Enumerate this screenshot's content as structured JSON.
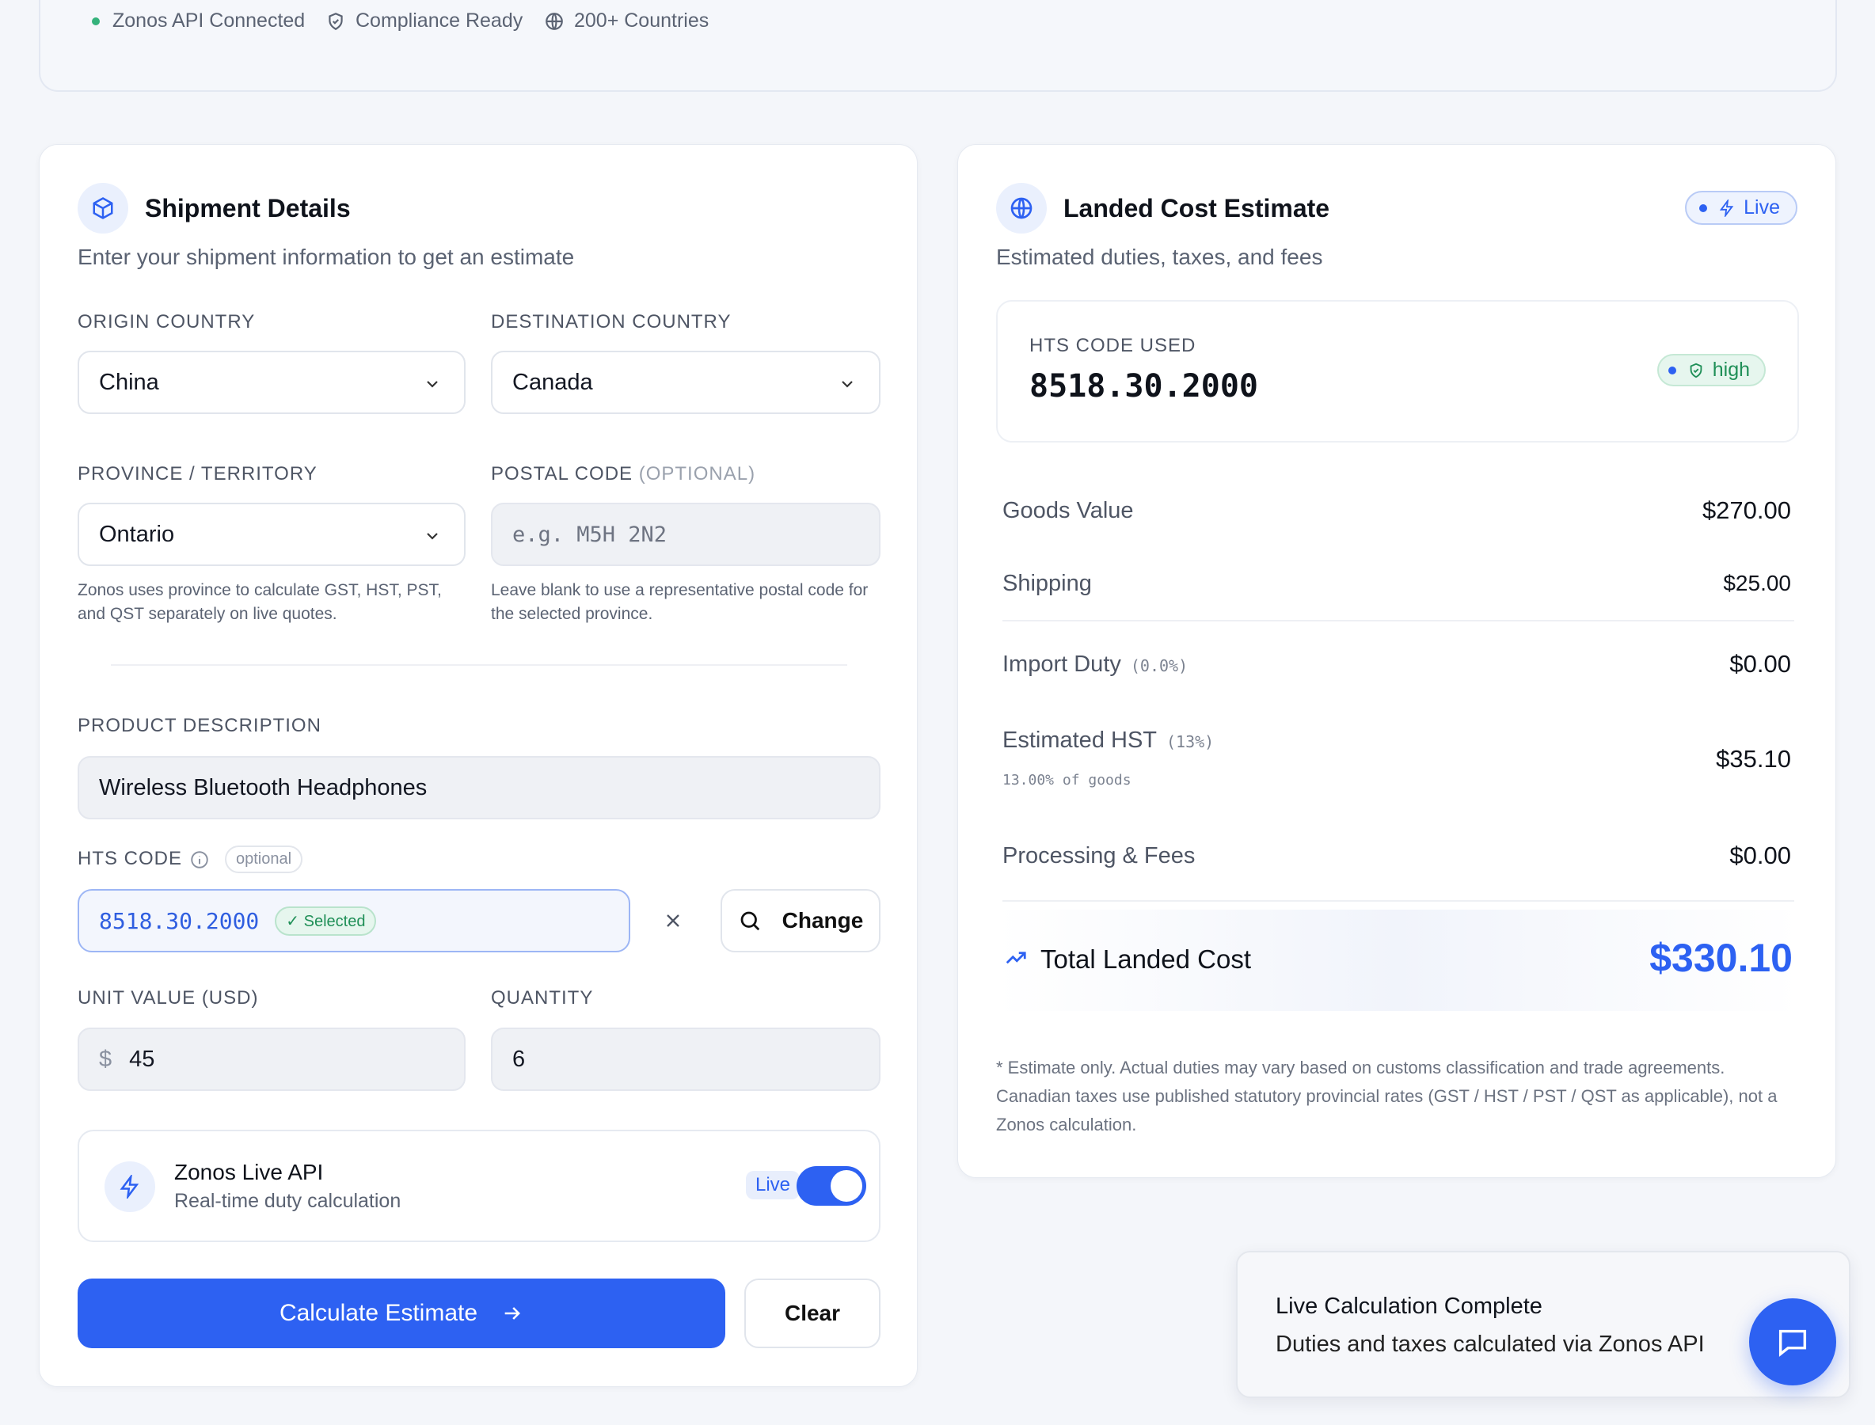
{
  "status_bar": {
    "api": "Zonos API Connected",
    "compliance": "Compliance Ready",
    "countries": "200+ Countries"
  },
  "shipment": {
    "title": "Shipment Details",
    "subtitle": "Enter your shipment information to get an estimate",
    "origin_label": "ORIGIN COUNTRY",
    "origin_value": "China",
    "destination_label": "DESTINATION COUNTRY",
    "destination_value": "Canada",
    "province_label": "PROVINCE / TERRITORY",
    "province_value": "Ontario",
    "province_hint": "Zonos uses province to calculate GST, HST, PST, and QST separately on live quotes.",
    "postal_label": "POSTAL CODE",
    "postal_optional": "(OPTIONAL)",
    "postal_placeholder": "e.g. M5H 2N2",
    "postal_hint": "Leave blank to use a representative postal code for the selected province.",
    "product_label": "PRODUCT DESCRIPTION",
    "product_value": "Wireless Bluetooth Headphones",
    "hts_label": "HTS CODE",
    "hts_optional": "optional",
    "hts_value": "8518.30.2000",
    "hts_selected": "✓ Selected",
    "change_label": "Change",
    "unit_label": "UNIT VALUE (USD)",
    "unit_value": "45",
    "quantity_label": "QUANTITY",
    "quantity_value": "6",
    "live_title": "Zonos Live API",
    "live_subtitle": "Real-time duty calculation",
    "live_pill": "Live",
    "live_enabled": true,
    "calculate_label": "Calculate Estimate",
    "clear_label": "Clear"
  },
  "estimate": {
    "title": "Landed Cost Estimate",
    "subtitle": "Estimated duties, taxes, and fees",
    "live_chip": "Live",
    "hts_used_label": "HTS CODE USED",
    "hts_used_value": "8518.30.2000",
    "confidence": "high",
    "rows": [
      {
        "label": "Goods Value",
        "value": "$270.00"
      },
      {
        "label": "Shipping",
        "value": "$25.00"
      },
      {
        "label": "Import Duty",
        "pct": "(0.0%)",
        "value": "$0.00"
      },
      {
        "label": "Estimated HST",
        "pct": "(13%)",
        "sub": "13.00% of goods",
        "value": "$35.10"
      },
      {
        "label": "Processing & Fees",
        "value": "$0.00"
      }
    ],
    "total_label": "Total Landed Cost",
    "total_value": "$330.10",
    "disclaimer": "* Estimate only. Actual duties may vary based on customs classification and trade agreements. Canadian taxes use published statutory provincial rates (GST / HST / PST / QST as applicable), not a Zonos calculation."
  },
  "toast": {
    "title": "Live Calculation Complete",
    "message": "Duties and taxes calculated via Zonos API"
  },
  "colors": {
    "accent": "#2d61f2",
    "success": "#1f8f57",
    "background": "#f4f6fa"
  }
}
